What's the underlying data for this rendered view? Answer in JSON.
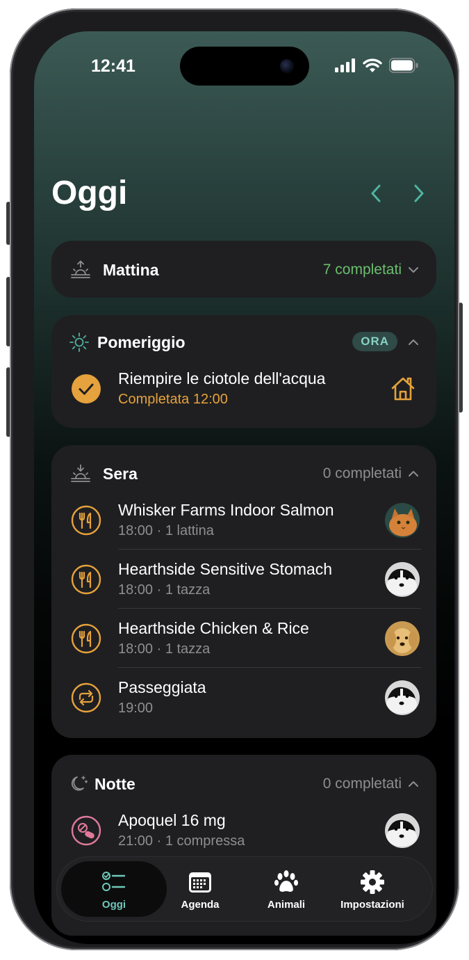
{
  "status_bar": {
    "time": "12:41"
  },
  "header": {
    "title": "Oggi"
  },
  "colors": {
    "accent_teal": "#4fb3a2",
    "accent_orange": "#e6a23c",
    "completed_green": "#6bbf6e",
    "pill_pink": "#e07a9a"
  },
  "sections": {
    "morning": {
      "title": "Mattina",
      "count": "7 completati",
      "icon": "sunrise-icon"
    },
    "afternoon": {
      "title": "Pomeriggio",
      "badge": "ORA",
      "icon": "sun-icon",
      "items": [
        {
          "title": "Riempire le ciotole dell'acqua",
          "subtitle": "Completata 12:00",
          "icon": "check-circle-icon",
          "trailing_icon": "home-icon"
        }
      ]
    },
    "evening": {
      "title": "Sera",
      "count": "0 completati",
      "icon": "sunset-icon",
      "items": [
        {
          "title": "Whisker Farms Indoor Salmon",
          "subtitle": "18:00 · 1 lattina",
          "icon": "food-icon",
          "avatar": "cat-avatar"
        },
        {
          "title": "Hearthside Sensitive Stomach",
          "subtitle": "18:00 · 1 tazza",
          "icon": "food-icon",
          "avatar": "border-collie-avatar"
        },
        {
          "title": "Hearthside Chicken & Rice",
          "subtitle": "18:00 · 1 tazza",
          "icon": "food-icon",
          "avatar": "golden-retriever-avatar"
        },
        {
          "title": "Passeggiata",
          "subtitle": "19:00",
          "icon": "repeat-icon",
          "avatar": "border-collie-avatar"
        }
      ]
    },
    "night": {
      "title": "Notte",
      "count": "0 completati",
      "icon": "moon-icon",
      "items": [
        {
          "title": "Apoquel 16 mg",
          "subtitle": "21:00 · 1 compressa",
          "icon": "pill-icon",
          "avatar": "border-collie-avatar"
        }
      ]
    }
  },
  "tabbar": {
    "tabs": [
      {
        "label": "Oggi",
        "icon": "checklist-icon",
        "active": true
      },
      {
        "label": "Agenda",
        "icon": "calendar-icon"
      },
      {
        "label": "Animali",
        "icon": "paw-icon"
      },
      {
        "label": "Impostazioni",
        "icon": "gear-icon"
      }
    ]
  }
}
